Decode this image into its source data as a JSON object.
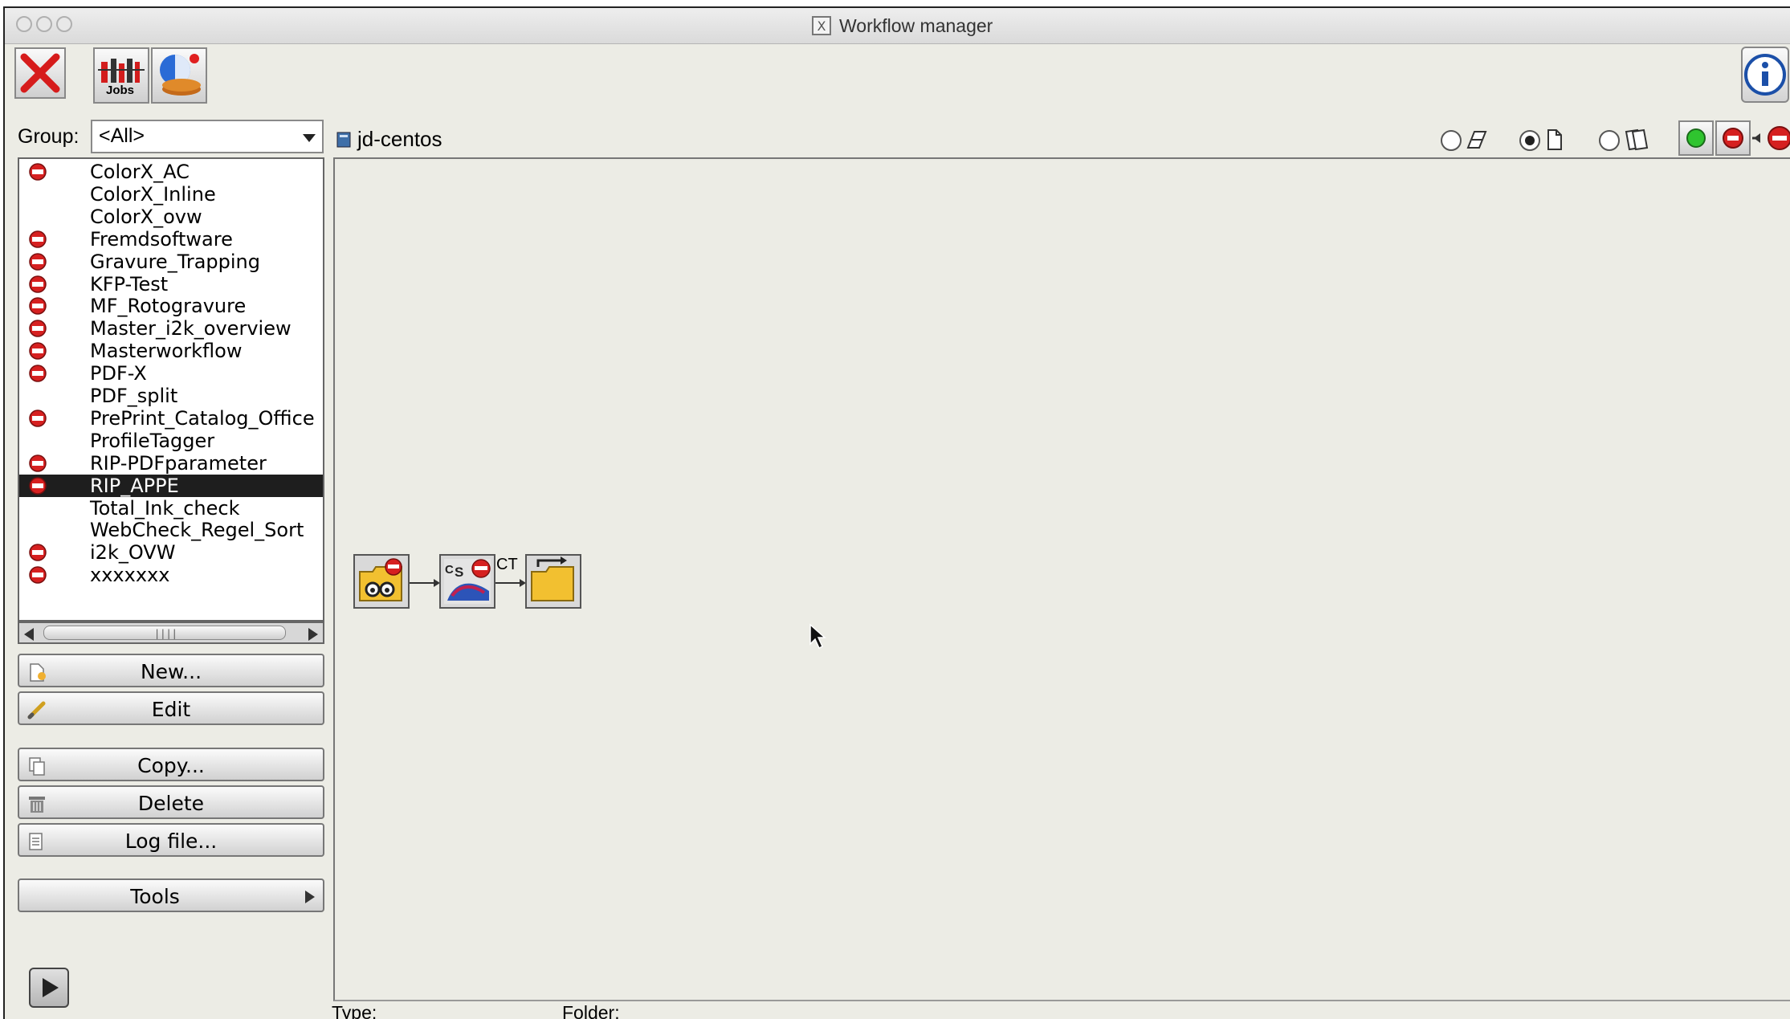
{
  "window": {
    "title": "Workflow manager",
    "title_icon": "X"
  },
  "toolbar": {
    "close": "close-icon",
    "jobs_label": "Jobs",
    "status": "status-globe-icon"
  },
  "group": {
    "label": "Group:",
    "selected": "<All>"
  },
  "host": "jd-centos",
  "workflows": [
    {
      "name": "ColorX_AC",
      "stopped": true
    },
    {
      "name": "ColorX_Inline",
      "stopped": false
    },
    {
      "name": "ColorX_ovw",
      "stopped": false
    },
    {
      "name": "Fremdsoftware",
      "stopped": true
    },
    {
      "name": "Gravure_Trapping",
      "stopped": true
    },
    {
      "name": "KFP-Test",
      "stopped": true
    },
    {
      "name": "MF_Rotogravure",
      "stopped": true
    },
    {
      "name": "Master_i2k_overview",
      "stopped": true
    },
    {
      "name": "Masterworkflow",
      "stopped": true
    },
    {
      "name": "PDF-X",
      "stopped": true
    },
    {
      "name": "PDF_split",
      "stopped": false
    },
    {
      "name": "PrePrint_Catalog_Office",
      "stopped": true
    },
    {
      "name": "ProfileTagger",
      "stopped": false
    },
    {
      "name": "RIP-PDFparameter",
      "stopped": true
    },
    {
      "name": "RIP_APPE",
      "stopped": true,
      "selected": true
    },
    {
      "name": "Total_Ink_check",
      "stopped": false
    },
    {
      "name": "WebCheck_Regel_Sort",
      "stopped": false
    },
    {
      "name": "i2k_OVW",
      "stopped": true
    },
    {
      "name": "xxxxxxx",
      "stopped": true
    }
  ],
  "buttons": {
    "new": "New...",
    "edit": "Edit",
    "copy": "Copy...",
    "delete": "Delete",
    "log": "Log file...",
    "tools": "Tools"
  },
  "flow": {
    "connector_label": "CT"
  },
  "status": {
    "type_label": "Type:",
    "folder_label": "Folder:"
  },
  "colors": {
    "stop": "#d62020",
    "selection": "#1e1e1e",
    "run": "#2fc42f"
  }
}
